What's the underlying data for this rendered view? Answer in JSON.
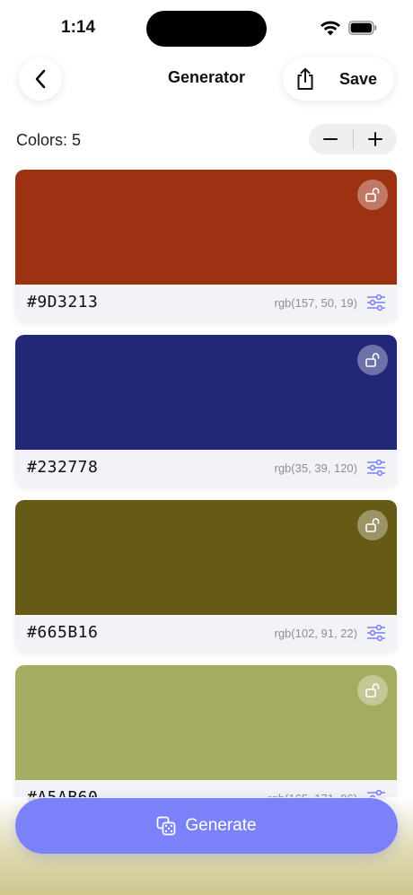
{
  "status_bar": {
    "time": "1:14"
  },
  "nav": {
    "title": "Generator",
    "save_label": "Save"
  },
  "colors_count": {
    "label": "Colors: 5",
    "minus": "−",
    "plus": "+"
  },
  "palette": [
    {
      "hex": "#9D3213",
      "rgb": "rgb(157, 50, 19)",
      "color": "#9D3213"
    },
    {
      "hex": "#232778",
      "rgb": "rgb(35, 39, 120)",
      "color": "#232778"
    },
    {
      "hex": "#665B16",
      "rgb": "rgb(102, 91, 22)",
      "color": "#665B16"
    },
    {
      "hex": "#A5AB60",
      "rgb": "rgb(165, 171, 96)",
      "color": "#A5AB60"
    }
  ],
  "generate": {
    "label": "Generate"
  },
  "theme": {
    "accent": "#7B82F9",
    "adjust_icon": "#7B82F9"
  }
}
